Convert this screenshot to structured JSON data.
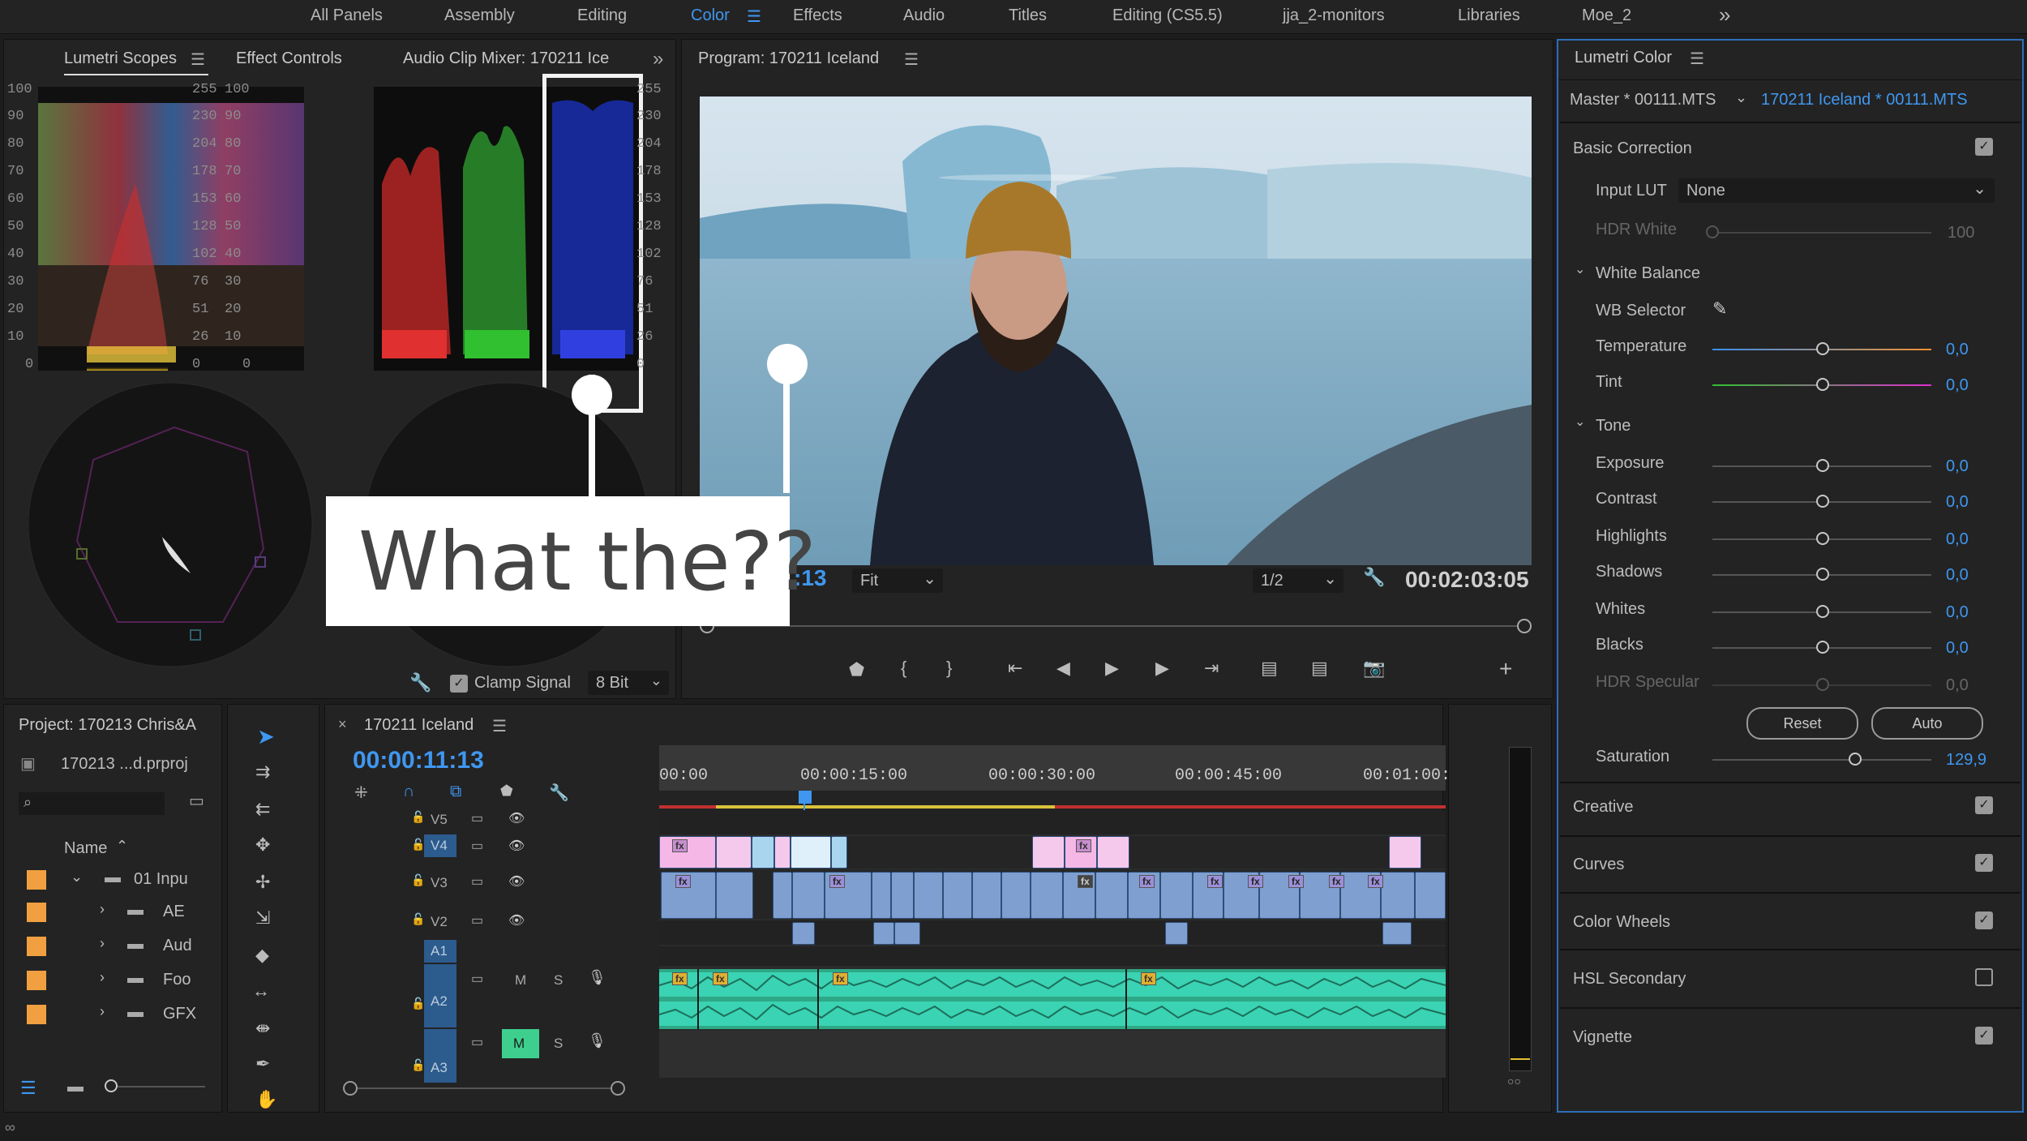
{
  "workspace_tabs": [
    "All Panels",
    "Assembly",
    "Editing",
    "Color",
    "Effects",
    "Audio",
    "Titles",
    "Editing (CS5.5)",
    "jja_2-monitors",
    "Libraries",
    "Moe_2"
  ],
  "workspace_active": "Color",
  "overflow_glyph": "»",
  "menu_glyph": "☰",
  "scopes": {
    "tabs": [
      "Lumetri Scopes",
      "Effect Controls",
      "Audio Clip Mixer: 170211 Ice"
    ],
    "ticks_left": [
      "100",
      "90",
      "80",
      "70",
      "60",
      "50",
      "40",
      "30",
      "20",
      "10",
      "0"
    ],
    "ticks_mid": [
      "255",
      "230",
      "204",
      "178",
      "153",
      "128",
      "102",
      "76",
      "51",
      "26",
      "0"
    ],
    "clamp_label": "Clamp Signal",
    "bit_depth": "8 Bit"
  },
  "annotation": {
    "text": "What the??"
  },
  "program": {
    "title": "Program: 170211 Iceland",
    "timecode_partial": ":13",
    "fit": "Fit",
    "resolution": "1/2",
    "duration": "00:02:03:05"
  },
  "lumetri": {
    "title": "Lumetri Color",
    "master": "Master * 00111.MTS",
    "clip": "170211 Iceland * 00111.MTS",
    "basic": "Basic Correction",
    "input_lut_label": "Input LUT",
    "input_lut_value": "None",
    "hdr_white_label": "HDR White",
    "hdr_white_value": "100",
    "white_balance": "White Balance",
    "wb_selector": "WB Selector",
    "temperature": "Temperature",
    "tint": "Tint",
    "tone": "Tone",
    "exposure": "Exposure",
    "contrast": "Contrast",
    "highlights": "Highlights",
    "shadows": "Shadows",
    "whites": "Whites",
    "blacks": "Blacks",
    "hdr_specular": "HDR Specular",
    "zero": "0,0",
    "reset": "Reset",
    "auto": "Auto",
    "saturation": "Saturation",
    "saturation_value": "129,9",
    "sections": [
      "Creative",
      "Curves",
      "Color Wheels",
      "HSL Secondary",
      "Vignette"
    ],
    "sections_checked": [
      true,
      true,
      true,
      false,
      true
    ]
  },
  "project": {
    "title": "Project: 170213 Chris&A",
    "file": "170213 ...d.prproj",
    "name_col": "Name",
    "items": [
      "01 Inpu",
      "AE",
      "Aud",
      "Foo",
      "GFX"
    ]
  },
  "timeline": {
    "title": "170211 Iceland",
    "timecode": "00:00:11:13",
    "ruler": [
      "00:00",
      "00:00:15:00",
      "00:00:30:00",
      "00:00:45:00",
      "00:01:00:0"
    ],
    "video_tracks": [
      "V5",
      "V4",
      "V3",
      "V2"
    ],
    "audio_tracks": [
      "A1",
      "A2",
      "A3"
    ],
    "mute": "M",
    "solo": "S",
    "fx": "fx"
  },
  "colors": {
    "accent": "#3f97f0",
    "panel": "#232323",
    "audio": "#3ad3b3",
    "video": "#7f9fd0",
    "pink": "#f5b8e6"
  }
}
